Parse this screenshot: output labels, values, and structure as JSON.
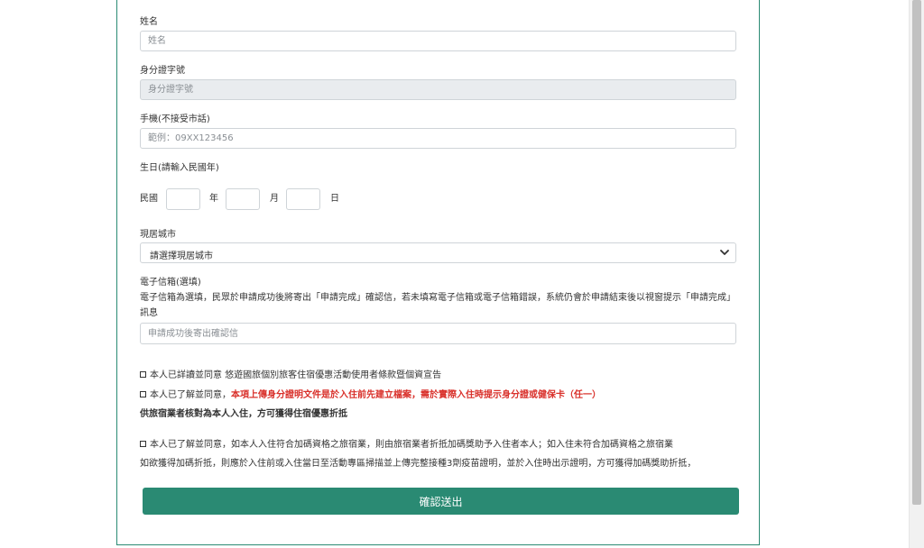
{
  "name": {
    "label": "姓名",
    "placeholder": "姓名"
  },
  "id_number": {
    "label": "身分證字號",
    "placeholder": "身分證字號"
  },
  "mobile": {
    "label": "手機(不接受市話)",
    "placeholder": "範例：09XX123456"
  },
  "birthday": {
    "label": "生日(請輸入民國年)",
    "era_label": "民國",
    "year_label": "年",
    "month_label": "月",
    "day_label": "日"
  },
  "city": {
    "label": "現居城市",
    "selected": "請選擇現居城市",
    "icon": "chevron-down-icon"
  },
  "email": {
    "label": "電子信箱(選填)",
    "description": "電子信箱為選填，民眾於申請成功後將寄出「申請完成」確認信，若未填寫電子信箱或電子信箱錯誤，系統仍會於申請結束後以視窗提示「申請完成」訊息",
    "placeholder": "申請成功後寄出確認信"
  },
  "agreements": {
    "terms": "本人已詳讀並同意 悠遊國旅個別旅客住宿優惠活動使用者條款暨個資宣告",
    "id_doc_prefix": "本人已了解並同意，",
    "id_doc_red_1": "本項上傳身分證明文件是於入住前先建立檔案，需於實際入住時提示身分證或健保卡（任一）",
    "id_doc_red_2": "供旅宿業者核對為本人入住，方可獲得住宿優惠折抵",
    "bonus_line_1": "本人已了解並同意，如本人入住符合加碼資格之旅宿業，則由旅宿業者折抵加碼獎助予入住者本人；如入住未符合加碼資格之旅宿業",
    "bonus_line_2": "如欲獲得加碼折抵，則應於入住前或入住當日至活動專區掃描並上傳完整接種3劑疫苗證明，並於入住時出示證明，方可獲得加碼獎助折抵，"
  },
  "submit_label": "確認送出",
  "colors": {
    "accent": "#2a8a73",
    "warning": "#d9302a",
    "disabled_bg": "#e9ecef"
  }
}
